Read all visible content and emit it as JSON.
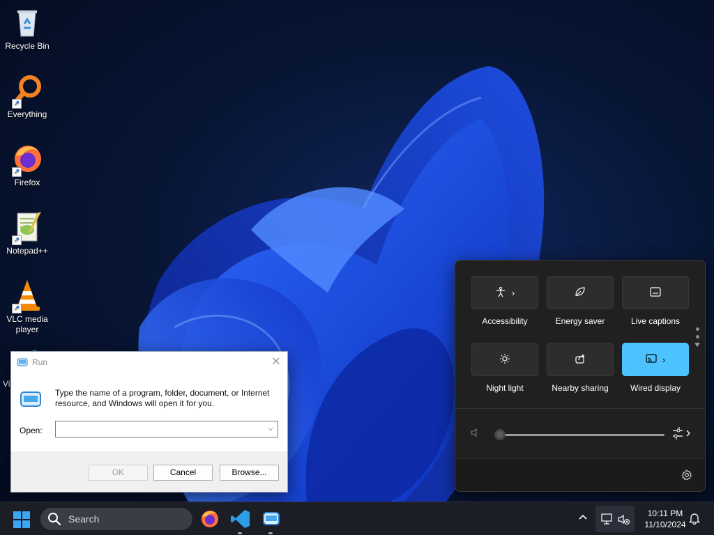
{
  "desktop": {
    "icons": [
      {
        "label": "Recycle Bin",
        "icon": "recycle-bin-icon"
      },
      {
        "label": "Everything",
        "icon": "everything-search-icon"
      },
      {
        "label": "Firefox",
        "icon": "firefox-icon"
      },
      {
        "label": "Notepad++",
        "icon": "notepad-plus-plus-icon"
      },
      {
        "label": "VLC media player",
        "icon": "vlc-cone-icon"
      },
      {
        "label": "Vi",
        "icon": "vscode-icon"
      }
    ]
  },
  "run_dialog": {
    "title": "Run",
    "description": "Type the name of a program, folder, document, or Internet resource, and Windows will open it for you.",
    "open_label": "Open:",
    "open_value": "",
    "ok_label": "OK",
    "cancel_label": "Cancel",
    "browse_label": "Browse..."
  },
  "quick_settings": {
    "tiles": [
      {
        "label": "Accessibility",
        "icon": "accessibility-icon",
        "has_chevron": true,
        "active": false
      },
      {
        "label": "Energy saver",
        "icon": "leaf-icon",
        "has_chevron": false,
        "active": false
      },
      {
        "label": "Live captions",
        "icon": "captions-icon",
        "has_chevron": false,
        "active": false
      },
      {
        "label": "Night light",
        "icon": "sun-icon",
        "has_chevron": false,
        "active": false
      },
      {
        "label": "Nearby sharing",
        "icon": "share-icon",
        "has_chevron": false,
        "active": false
      },
      {
        "label": "Wired display",
        "icon": "cast-icon",
        "has_chevron": true,
        "active": true
      }
    ],
    "volume_level": 0,
    "chevron_glyph": "›",
    "accent": "#4cc2ff"
  },
  "taskbar": {
    "search_placeholder": "Search",
    "pinned": [
      "firefox-icon",
      "vscode-icon",
      "run-icon"
    ],
    "time": "10:11 PM",
    "date": "11/10/2024",
    "accent": "#3aa6f4"
  }
}
